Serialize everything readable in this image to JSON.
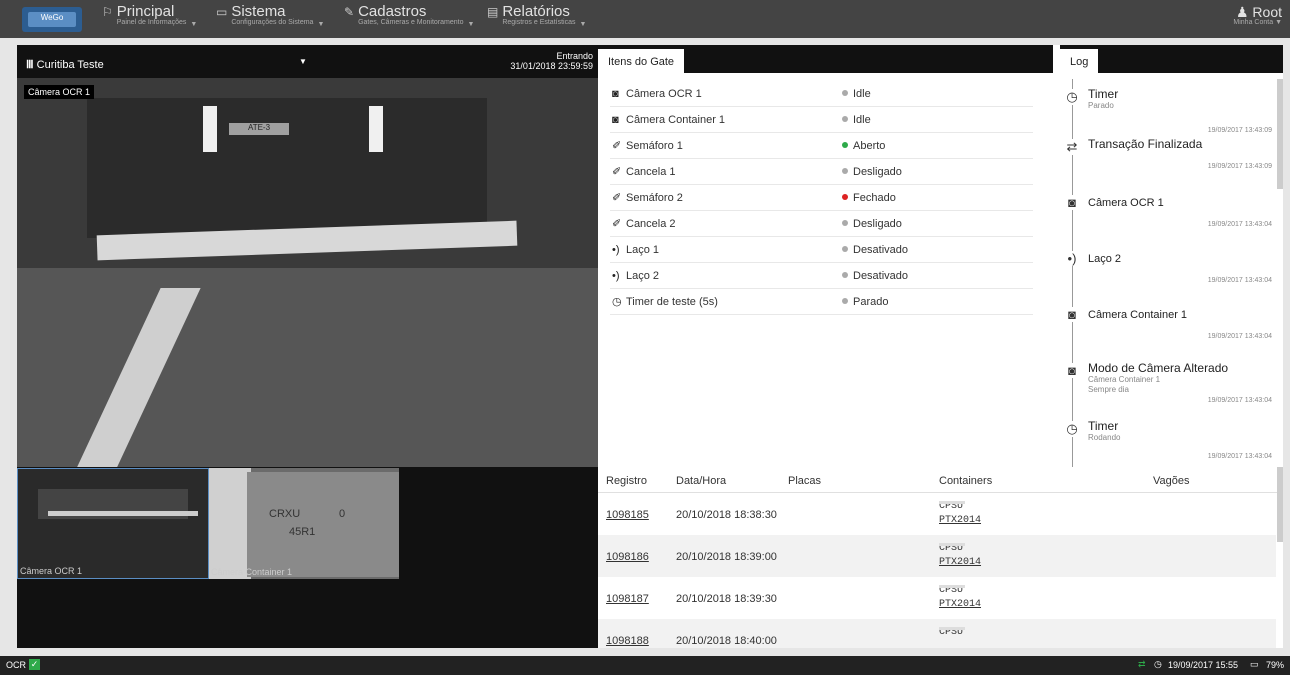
{
  "brand": {
    "logo_text": "WeGo"
  },
  "nav": [
    {
      "label": "Principal",
      "sub": "Painel de Informações",
      "icon": "flag-icon",
      "glyph": "⚐"
    },
    {
      "label": "Sistema",
      "sub": "Configurações do Sistema",
      "icon": "monitor-icon",
      "glyph": "▭"
    },
    {
      "label": "Cadastros",
      "sub": "Gates, Câmeras e Monitoramento",
      "icon": "edit-icon",
      "glyph": "✎"
    },
    {
      "label": "Relatórios",
      "sub": "Registros e Estatísticas",
      "icon": "report-icon",
      "glyph": "▤"
    }
  ],
  "user": {
    "name": "Root",
    "sub": "Minha Conta"
  },
  "camera": {
    "select": "Curitiba Teste",
    "status": "Entrando",
    "datetime": "31/01/2018 23:59:59",
    "main_label": "Câmera OCR 1",
    "plate_text": "ATE-3"
  },
  "thumbs": [
    {
      "label": "Câmera OCR 1"
    },
    {
      "label": "Câmera Container 1",
      "code1": "CRXU",
      "code2": "0",
      "code3": "45R1"
    }
  ],
  "gate": {
    "tab": "Itens do Gate",
    "items": [
      {
        "name": "Câmera OCR 1",
        "icon": "camera-icon",
        "glyph": "◙",
        "status": "Idle",
        "color": "#aaaaaa"
      },
      {
        "name": "Câmera Container 1",
        "icon": "camera-icon",
        "glyph": "◙",
        "status": "Idle",
        "color": "#aaaaaa"
      },
      {
        "name": "Semáforo 1",
        "icon": "plug-icon",
        "glyph": "✐",
        "status": "Aberto",
        "color": "#2eaa4a"
      },
      {
        "name": "Cancela 1",
        "icon": "plug-icon",
        "glyph": "✐",
        "status": "Desligado",
        "color": "#aaaaaa"
      },
      {
        "name": "Semáforo 2",
        "icon": "plug-icon",
        "glyph": "✐",
        "status": "Fechado",
        "color": "#dd2222"
      },
      {
        "name": "Cancela 2",
        "icon": "plug-icon",
        "glyph": "✐",
        "status": "Desligado",
        "color": "#aaaaaa"
      },
      {
        "name": "Laço 1",
        "icon": "signal-icon",
        "glyph": "•)",
        "status": "Desativado",
        "color": "#aaaaaa"
      },
      {
        "name": "Laço 2",
        "icon": "signal-icon",
        "glyph": "•)",
        "status": "Desativado",
        "color": "#aaaaaa"
      },
      {
        "name": "Timer de teste (5s)",
        "icon": "timer-icon",
        "glyph": "◷",
        "status": "Parado",
        "color": "#aaaaaa"
      }
    ]
  },
  "log": {
    "tab": "Log",
    "entries": [
      {
        "title": "Timer",
        "sub": "Parado",
        "icon": "timer-icon",
        "glyph": "◷",
        "time": "19/09/2017 13:43:09",
        "big": true
      },
      {
        "title": "Transação Finalizada",
        "sub": "",
        "icon": "exchange-icon",
        "glyph": "⇄",
        "time": "19/09/2017 13:43:09",
        "big": true
      },
      {
        "title": "Câmera OCR 1",
        "sub": "",
        "icon": "camera-icon",
        "glyph": "◙",
        "time": "19/09/2017 13:43:04",
        "big": false
      },
      {
        "title": "Laço 2",
        "sub": "",
        "icon": "signal-icon",
        "glyph": "•)",
        "time": "19/09/2017 13:43:04",
        "big": false
      },
      {
        "title": "Câmera Container 1",
        "sub": "",
        "icon": "camera-icon",
        "glyph": "◙",
        "time": "19/09/2017 13:43:04",
        "big": false
      },
      {
        "title": "Modo de Câmera Alterado",
        "sub": "Câmera Container 1\nSempre dia",
        "icon": "camera-icon",
        "glyph": "◙",
        "time": "19/09/2017 13:43:04",
        "big": true
      },
      {
        "title": "Timer",
        "sub": "Rodando",
        "icon": "timer-icon",
        "glyph": "◷",
        "time": "19/09/2017 13:43:04",
        "big": true
      }
    ]
  },
  "records": {
    "headers": [
      "Registro",
      "Data/Hora",
      "Placas",
      "Containers",
      "Vagões"
    ],
    "rows": [
      {
        "id": "1098185",
        "date": "20/10/2018 18:38:30",
        "c1": "CPSU",
        "c2": "PTX2014"
      },
      {
        "id": "1098186",
        "date": "20/10/2018 18:39:00",
        "c1": "CPSU",
        "c2": "PTX2014"
      },
      {
        "id": "1098187",
        "date": "20/10/2018 18:39:30",
        "c1": "CPSU",
        "c2": "PTX2014"
      },
      {
        "id": "1098188",
        "date": "20/10/2018 18:40:00",
        "c1": "CPSU",
        "c2": ""
      }
    ]
  },
  "status": {
    "left": "OCR",
    "datetime": "19/09/2017 15:55",
    "battery": "79%",
    "accent": "#2eaa4a"
  }
}
